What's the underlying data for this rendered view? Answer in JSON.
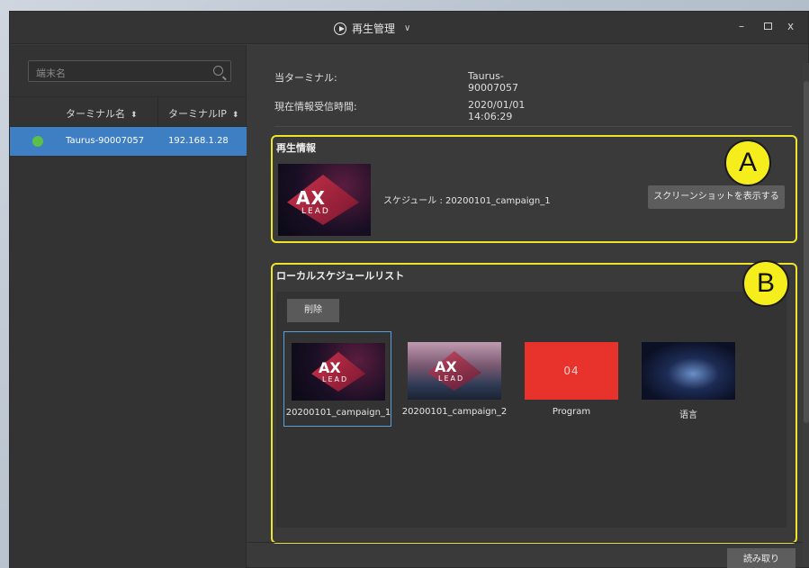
{
  "title": {
    "text": "再生管理"
  },
  "window": {
    "min": "–",
    "close": "x"
  },
  "sidebar": {
    "search_placeholder": "端末名",
    "columns": [
      "ターミナル名",
      "ターミナルIP"
    ],
    "rows": [
      {
        "name": "Taurus-90007057",
        "ip": "192.168.1.28",
        "status": "online",
        "status_color": "#5bbf4a"
      }
    ]
  },
  "info": {
    "terminal_label": "当ターミナル:",
    "terminal_value": "Taurus-90007057",
    "time_label": "現在情報受信時間:",
    "time_value": "2020/01/01 14:06:29"
  },
  "playback": {
    "title": "再生情報",
    "schedule_text": "スケジュール : 20200101_campaign_1",
    "screenshot_button": "スクリーンショットを表示する",
    "thumb_logo": "AX",
    "thumb_sub": "LEAD"
  },
  "local_schedule": {
    "title": "ローカルスケジュールリスト",
    "delete_button": "削除",
    "items": [
      {
        "label": "20200101_campaign_1",
        "selected": true,
        "logo": "AX",
        "sub": "LEAD"
      },
      {
        "label": "20200101_campaign_2",
        "selected": false,
        "logo": "AX",
        "sub": "LEAD"
      },
      {
        "label": "Program",
        "selected": false,
        "thumb_text": "04"
      },
      {
        "label": "语言",
        "selected": false
      }
    ]
  },
  "annotations": {
    "a": "A",
    "b": "B"
  },
  "footer": {
    "read_button": "読み取り"
  },
  "colors": {
    "accent": "#3e7ec3",
    "highlight": "#ece52c",
    "badge": "#f5ee1c"
  }
}
